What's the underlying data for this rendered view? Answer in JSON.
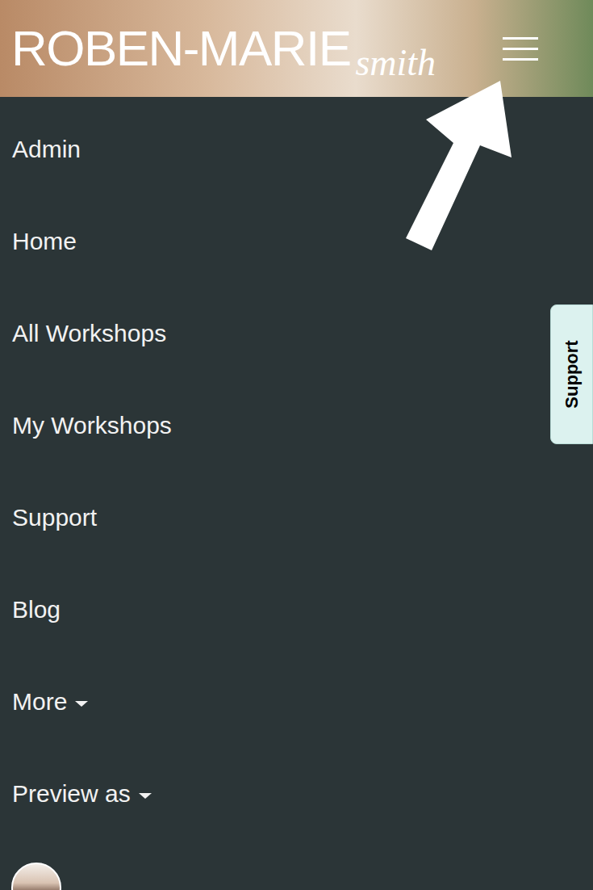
{
  "header": {
    "logo": {
      "name": "ROBEN-MARIE",
      "surname": "smith"
    }
  },
  "menu": {
    "items": [
      {
        "label": "Admin",
        "dropdown": false
      },
      {
        "label": "Home",
        "dropdown": false
      },
      {
        "label": "All Workshops",
        "dropdown": false
      },
      {
        "label": "My Workshops",
        "dropdown": false
      },
      {
        "label": "Support",
        "dropdown": false
      },
      {
        "label": "Blog",
        "dropdown": false
      },
      {
        "label": "More",
        "dropdown": true
      },
      {
        "label": "Preview as",
        "dropdown": true
      }
    ]
  },
  "support_tab": {
    "label": "Support"
  }
}
